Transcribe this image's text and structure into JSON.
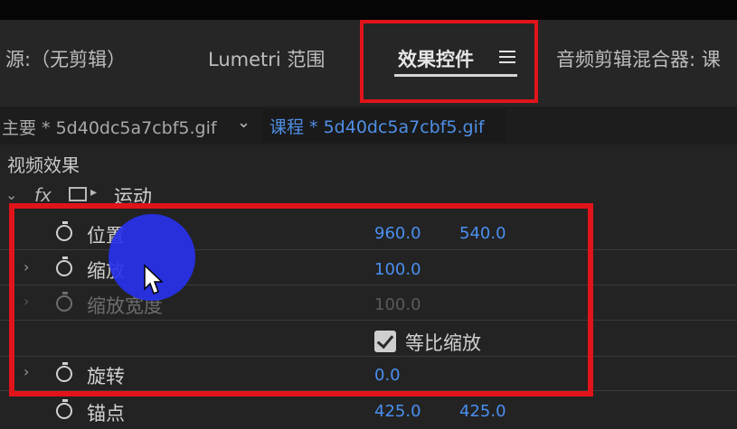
{
  "tabs": [
    {
      "label": "源:（无剪辑）"
    },
    {
      "label": "Lumetri 范围"
    },
    {
      "label": "效果控件"
    },
    {
      "label": "音频剪辑混合器: 课"
    }
  ],
  "active_tab_menu_icon": "hamburger-menu-icon",
  "clip_header": {
    "master_clip": "主要 * 5d40dc5a7cbf5.gif",
    "sequence_clip": "课程 * 5d40dc5a7cbf5.gif"
  },
  "effects": {
    "section_title": "视频效果",
    "motion_label": "运动",
    "properties": [
      {
        "name": "位置",
        "value1": "960.0",
        "value2": "540.0"
      },
      {
        "name": "缩放",
        "value1": "100.0"
      },
      {
        "name": "缩放宽度",
        "value1": "100.0"
      },
      {
        "name": "旋转",
        "value1": "0.0"
      },
      {
        "name": "锚点",
        "value1": "425.0",
        "value2": "425.0"
      }
    ],
    "uniform_scale_label": "等比缩放",
    "uniform_scale_checked": true
  },
  "colors": {
    "highlight": "#e0141a",
    "value_blue": "#4a8ff0",
    "cursor_halo": "#2832eb"
  }
}
